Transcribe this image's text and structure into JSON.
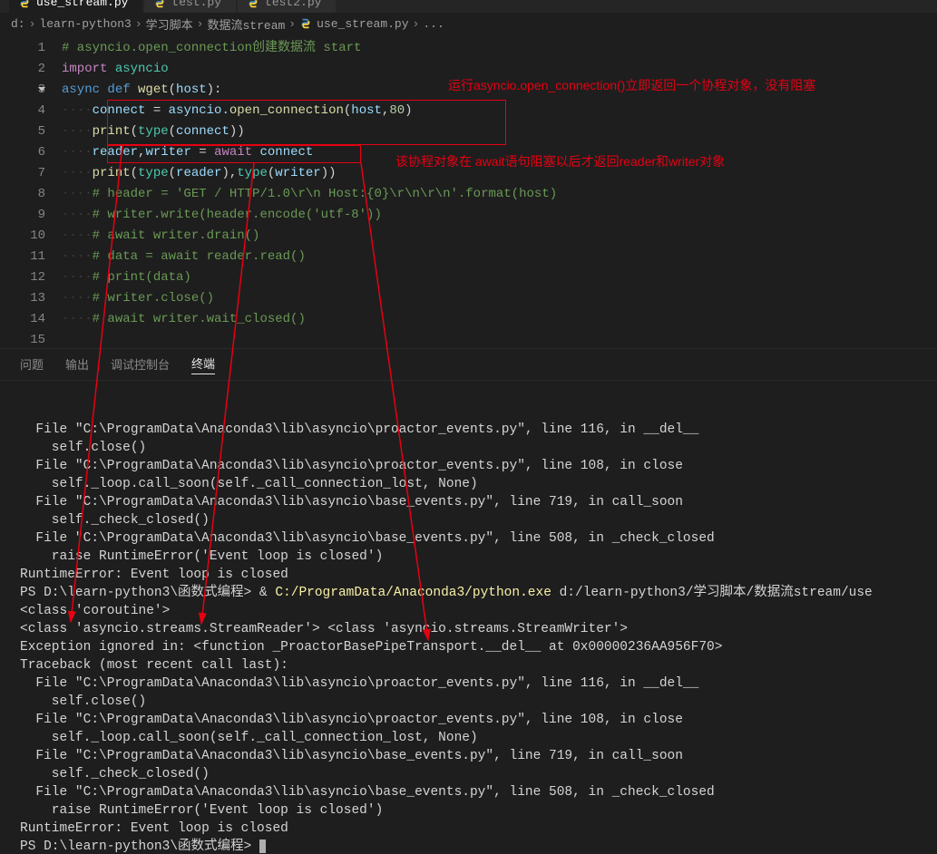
{
  "tabs": [
    {
      "label": "use_stream.py",
      "active": true,
      "icon": "python-icon"
    },
    {
      "label": "test.py",
      "active": false,
      "icon": "python-icon"
    },
    {
      "label": "test2.py",
      "active": false,
      "icon": "python-icon"
    }
  ],
  "breadcrumbs": {
    "drive": "d:",
    "parts": [
      "learn-python3",
      "学习脚本",
      "数据流stream"
    ],
    "file": "use_stream.py",
    "trail": "..."
  },
  "lines": {
    "count": 15,
    "foldAt": 3
  },
  "code": {
    "l1_cm": "# asyncio.open_connection创建数据流 start",
    "l2_kw": "import",
    "l2_mod": " asyncio",
    "l3_kw1": "async ",
    "l3_kw2": "def ",
    "l3_fn": "wget",
    "l3_rest1": "(",
    "l3_arg": "host",
    "l3_rest2": "):",
    "ws4": "····",
    "ws8": "········",
    "l4_var": "connect",
    "l4_eq": " = ",
    "l4_mod": "asyncio.",
    "l4_fn": "open_connection",
    "l4_rest1": "(",
    "l4_arg": "host",
    "l4_comma": ",",
    "l4_num": "80",
    "l4_rest2": ")",
    "l5_fn": "print",
    "l5_op": "(",
    "l5_tp": "type",
    "l5_in": "(",
    "l5_v": "connect",
    "l5_cl": "))",
    "l6_var1": "reader",
    "l6_comma": ",",
    "l6_var2": "writer",
    "l6_eq": " = ",
    "l6_aw": "await",
    "l6_sp": " ",
    "l6_v": "connect",
    "l7_fn": "print",
    "l7_op": "(",
    "l7_tp": "type",
    "l7_in": "(",
    "l7_v1": "reader",
    "l7_cl1": "),",
    "l7_tp2": "type",
    "l7_in2": "(",
    "l7_v2": "writer",
    "l7_cl": "))",
    "l8_cm": "# header = 'GET / HTTP/1.0\\r\\n Host:{0}\\r\\n\\r\\n'.format(host)",
    "l9_cm": "# writer.write(header.encode('utf-8'))",
    "l10_cm": "# await writer.drain()",
    "l11_cm": "# data = await reader.read()",
    "l12_cm": "# print(data)",
    "l13_cm": "# writer.close()",
    "l14_cm": "# await writer.wait_closed()"
  },
  "annotations": {
    "label1": "运行asyncio.open_connection()立即返回一个协程对象，没有阻塞",
    "label2": "该协程对象在 await语句阻塞以后才返回reader和writer对象"
  },
  "panel": {
    "tabs": [
      "问题",
      "输出",
      "调试控制台",
      "终端"
    ],
    "active": 3
  },
  "terminal_lines": [
    "  File \"C:\\ProgramData\\Anaconda3\\lib\\asyncio\\proactor_events.py\", line 116, in __del__",
    "    self.close()",
    "  File \"C:\\ProgramData\\Anaconda3\\lib\\asyncio\\proactor_events.py\", line 108, in close",
    "    self._loop.call_soon(self._call_connection_lost, None)",
    "  File \"C:\\ProgramData\\Anaconda3\\lib\\asyncio\\base_events.py\", line 719, in call_soon",
    "    self._check_closed()",
    "  File \"C:\\ProgramData\\Anaconda3\\lib\\asyncio\\base_events.py\", line 508, in _check_closed",
    "    raise RuntimeError('Event loop is closed')",
    "RuntimeError: Event loop is closed"
  ],
  "prompt_line": {
    "prefix": "PS D:\\learn-python3\\函数式编程> & ",
    "exe": "C:/ProgramData/Anaconda3/python.exe",
    "args": " d:/learn-python3/学习脚本/数据流stream/use"
  },
  "output_lines": [
    "<class 'coroutine'>",
    "<class 'asyncio.streams.StreamReader'> <class 'asyncio.streams.StreamWriter'>",
    "Exception ignored in: <function _ProactorBasePipeTransport.__del__ at 0x00000236AA956F70>",
    "Traceback (most recent call last):",
    "  File \"C:\\ProgramData\\Anaconda3\\lib\\asyncio\\proactor_events.py\", line 116, in __del__",
    "    self.close()",
    "  File \"C:\\ProgramData\\Anaconda3\\lib\\asyncio\\proactor_events.py\", line 108, in close",
    "    self._loop.call_soon(self._call_connection_lost, None)",
    "  File \"C:\\ProgramData\\Anaconda3\\lib\\asyncio\\base_events.py\", line 719, in call_soon",
    "    self._check_closed()",
    "  File \"C:\\ProgramData\\Anaconda3\\lib\\asyncio\\base_events.py\", line 508, in _check_closed",
    "    raise RuntimeError('Event loop is closed')",
    "RuntimeError: Event loop is closed",
    "PS D:\\learn-python3\\函数式编程> "
  ]
}
